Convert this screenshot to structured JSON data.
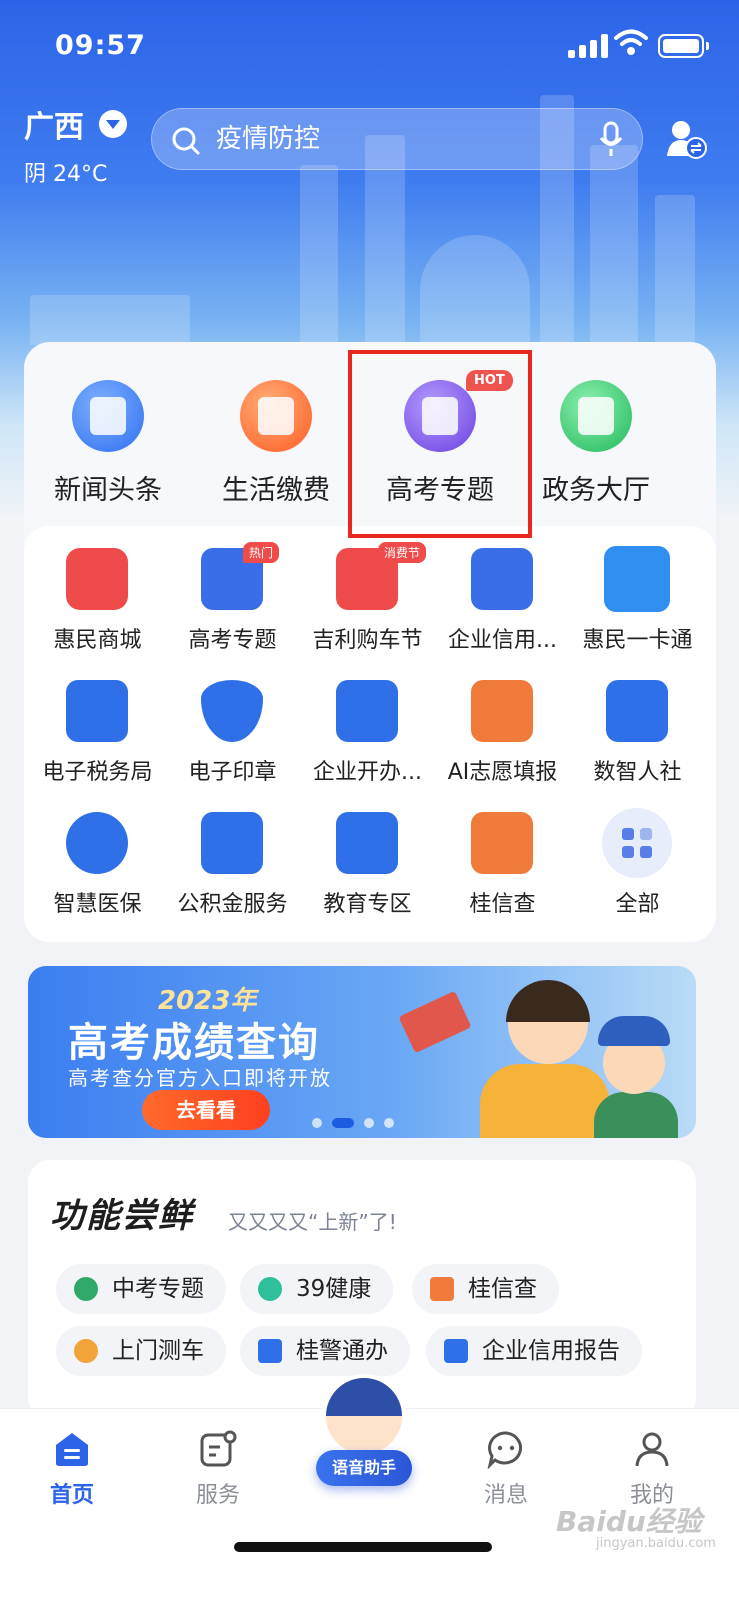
{
  "status": {
    "time": "09:57"
  },
  "header": {
    "location": "广西",
    "weather": "阴 24°C",
    "search_placeholder": "疫情防控"
  },
  "top_services": [
    {
      "label": "新闻头条",
      "icon": "news-icon",
      "color": "#3a7cf0"
    },
    {
      "label": "生活缴费",
      "icon": "bill-icon",
      "color": "#ff6a2a"
    },
    {
      "label": "高考专题",
      "icon": "graduation-cap-icon",
      "color": "#7b5cf0",
      "tag": "HOT"
    },
    {
      "label": "政务大厅",
      "icon": "government-hall-icon",
      "color": "#2fbf6a"
    }
  ],
  "grid_services": [
    {
      "label": "惠民商城",
      "icon": "shopping-bag-icon",
      "color": "#ef4b4b"
    },
    {
      "label": "高考专题",
      "icon": "id-card-icon",
      "color": "#3a6ee8",
      "tag": "热门"
    },
    {
      "label": "吉利购车节",
      "icon": "car-icon",
      "color": "#ef4b4b",
      "tag": "消费节"
    },
    {
      "label": "企业信用...",
      "icon": "credit-doc-icon",
      "color": "#3a6ee8"
    },
    {
      "label": "惠民一卡通",
      "icon": "wheat-heart-icon",
      "color": "#2f8ef0"
    },
    {
      "label": "电子税务局",
      "icon": "tax-screen-icon",
      "color": "#2f6fe8"
    },
    {
      "label": "电子印章",
      "icon": "seal-icon",
      "color": "#2f6fe8"
    },
    {
      "label": "企业开办...",
      "icon": "business-open-icon",
      "color": "#2f6fe8"
    },
    {
      "label": "AI志愿填报",
      "icon": "ai-volunteer-icon",
      "color": "#f07a3a"
    },
    {
      "label": "数智人社",
      "icon": "guangxi-social-icon",
      "color": "#2f6fe8"
    },
    {
      "label": "智慧医保",
      "icon": "heart-hands-icon",
      "color": "#2f6fe8"
    },
    {
      "label": "公积金服务",
      "icon": "housing-fund-icon",
      "color": "#2f6fe8"
    },
    {
      "label": "教育专区",
      "icon": "education-cap-icon",
      "color": "#2f6fe8"
    },
    {
      "label": "桂信查",
      "icon": "credit-check-icon",
      "color": "#f07a3a"
    },
    {
      "label": "全部",
      "icon": "all-apps-icon",
      "color": "#5a7ee8"
    }
  ],
  "banner": {
    "year": "2023年",
    "title": "高考成绩查询",
    "subtitle": "高考查分官方入口即将开放",
    "button": "去看看"
  },
  "features": {
    "title": "功能尝鲜",
    "subtitle": "又又又又“上新”了!",
    "chips": [
      {
        "label": "中考专题",
        "icon": "zhongkao-icon",
        "color": "#2fa86a"
      },
      {
        "label": "39健康",
        "icon": "health-heart-icon",
        "color": "#2fbf9a"
      },
      {
        "label": "桂信查",
        "icon": "credit-check-icon",
        "color": "#f07a3a"
      },
      {
        "label": "上门测车",
        "icon": "car-test-icon",
        "color": "#f0a43a"
      },
      {
        "label": "桂警通办",
        "icon": "police-icon",
        "color": "#2f6fe8"
      },
      {
        "label": "企业信用报告",
        "icon": "credit-report-icon",
        "color": "#2f6fe8"
      }
    ]
  },
  "tabbar": {
    "home": "首页",
    "services": "服务",
    "assistant": "语音助手",
    "messages": "消息",
    "mine": "我的"
  },
  "watermark": {
    "brand": "Baidu经验",
    "url": "jingyan.baidu.com"
  }
}
